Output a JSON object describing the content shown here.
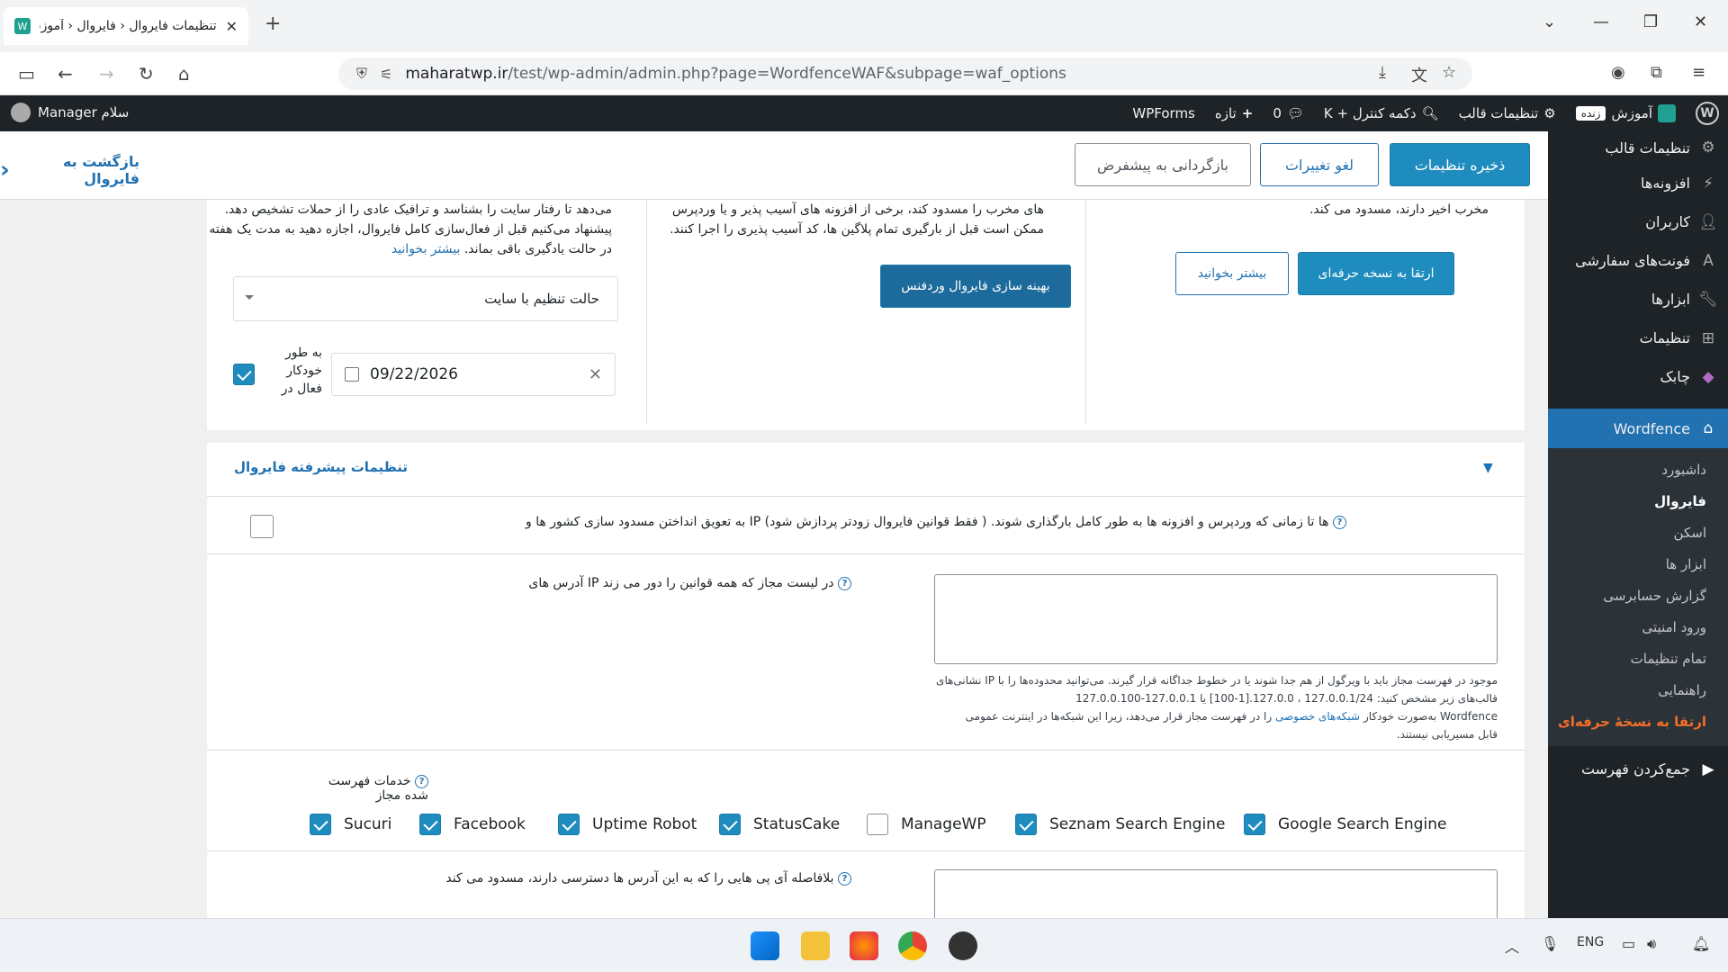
{
  "browser": {
    "tab_title": "تنظیمات فایروال ‹ فایروال ‹ آموزش",
    "url_domain": "maharatwp.ir",
    "url_path": "/test/wp-admin/admin.php?page=WordfenceWAF&subpage=waf_options"
  },
  "adminbar": {
    "site_name": "آموزش",
    "live_badge": "زنده",
    "customize": "تنظیمات قالب",
    "search": "دکمه کنترل + K",
    "comments_count": "0",
    "new": "تازه",
    "wpforms": "WPForms",
    "greeting": "سلام Manager"
  },
  "sidebar": {
    "items": [
      {
        "label": "تنظیمات قالب",
        "icon": "brush-icon"
      },
      {
        "label": "افزونه‌ها",
        "icon": "plugin-icon"
      },
      {
        "label": "کاربران",
        "icon": "users-icon"
      },
      {
        "label": "فونت‌های سفارشی",
        "icon": "font-icon"
      },
      {
        "label": "ابزارها",
        "icon": "wrench-icon"
      },
      {
        "label": "تنظیمات",
        "icon": "settings-icon"
      },
      {
        "label": "چابک",
        "icon": "chabok-icon"
      }
    ],
    "active": "Wordfence",
    "sub": [
      "داشبورد",
      "فایروال",
      "اسکن",
      "ابزار ها",
      "گزارش حسابرسی",
      "ورود امنیتی",
      "تمام تنظیمات",
      "راهنمایی",
      "ارتقا به نسخهٔ حرفه‌ای"
    ],
    "collapse": "جمع‌کردن فهرست"
  },
  "toolbar": {
    "save": "ذخیره تنظیمات",
    "cancel": "لغو تغییرات",
    "reset": "بازگردانی به پیشفرض",
    "back": "بازگشت به فایروال"
  },
  "cards": {
    "right_text": "مخرب اخیر دارند، مسدود می کند.",
    "right_btn_more": "بیشتر بخوانید",
    "right_btn_upgrade": "ارتقا به نسخه حرفه‌ای",
    "mid_text1": "های مخرب را مسدود کند، برخی از افزونه های آسیب پذیر و یا وردپرس",
    "mid_text2": "ممکن است قبل از بارگیری تمام پلاگین ها، کد آسیب پذیری را اجرا کنند.",
    "mid_btn": "بهینه سازی فایروال وردفنس",
    "left_text1": "می‌دهد تا رفتار سایت را بشناسد و ترافیک عادی را از حملات تشخیص دهد.",
    "left_text2": "پیشنهاد می‌کنیم قبل از فعال‌سازی کامل فایروال، اجازه دهید به مدت یک هفته",
    "left_text3": "در حالت یادگیری باقی بماند.",
    "left_link": "بیشتر بخوانید",
    "mode_select": "حالت تنظیم با سایت",
    "date": "09/22/2026",
    "auto_label": "به طور خودکار فعال در"
  },
  "advanced": {
    "title": "تنظیمات پیشرفته فایروال",
    "delay_text": "ها تا زمانی که وردپرس و افزونه ها به طور کامل بارگذاری شوند. ( فقط قوانین فایروال زودتر پردازش شود) IP به تعویق انداختن مسدود سازی کشور ها و",
    "whitelist_label": "در لیست مجاز که همه قوانین را دور می زند IP آدرس های",
    "whitelist_note1": "موجود در فهرست مجاز باید با ویرگول از هم جدا شوند یا در خطوط جداگانه قرار گیرند. می‌توانید محدوده‌ها را با IP نشانی‌های",
    "whitelist_note2": "قالب‌های زیر مشخص کنید: 127.0.0.1/24 ، 127.0.0.[1-100] یا 127.0.0.1-127.0.0.100",
    "whitelist_note3": "Wordfence به‌صورت خودکار",
    "whitelist_note3_link": "شبکه‌های خصوصی",
    "whitelist_note3b": "را در فهرست مجاز قرار می‌دهد، زیرا این شبکه‌ها در اینترنت عمومی",
    "whitelist_note4": "قابل مسیریابی نیستند.",
    "services_label": "خدمات فهرست شده مجاز",
    "services": [
      {
        "name": "Google Search Engine",
        "checked": true
      },
      {
        "name": "Seznam Search Engine",
        "checked": true
      },
      {
        "name": "ManageWP",
        "checked": false
      },
      {
        "name": "StatusCake",
        "checked": true
      },
      {
        "name": "Uptime Robot",
        "checked": true
      },
      {
        "name": "Facebook",
        "checked": true
      },
      {
        "name": "Sucuri",
        "checked": true
      }
    ],
    "block_label": "بلافاصله آی پی هایی را که به این آدرس ها دسترسی دارند، مسدود می کند"
  },
  "taskbar": {
    "lang": "ENG"
  }
}
